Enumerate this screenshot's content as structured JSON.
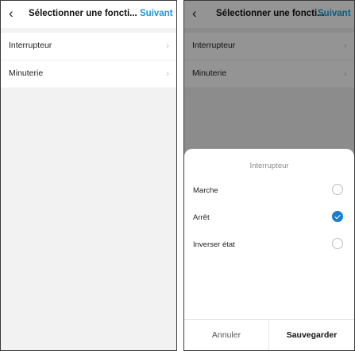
{
  "left": {
    "header": {
      "back_icon": "‹",
      "title": "Sélectionner une foncti...",
      "next_label": "Suivant"
    },
    "list": [
      {
        "label": "Interrupteur",
        "chevron": "›"
      },
      {
        "label": "Minuterie",
        "chevron": "›"
      }
    ]
  },
  "right": {
    "header": {
      "back_icon": "‹",
      "title": "Sélectionner une foncti...",
      "next_label": "Suivant"
    },
    "list": [
      {
        "label": "Interrupteur",
        "chevron": "›"
      },
      {
        "label": "Minuterie",
        "chevron": "›"
      }
    ],
    "sheet": {
      "title": "Interrupteur",
      "options": [
        {
          "label": "Marche",
          "selected": false
        },
        {
          "label": "Arrêt",
          "selected": true
        },
        {
          "label": "Inverser état",
          "selected": false
        }
      ],
      "cancel_label": "Annuler",
      "save_label": "Sauvegarder"
    }
  },
  "colors": {
    "accent": "#1a9bd7",
    "check": "#1a7dd0"
  }
}
